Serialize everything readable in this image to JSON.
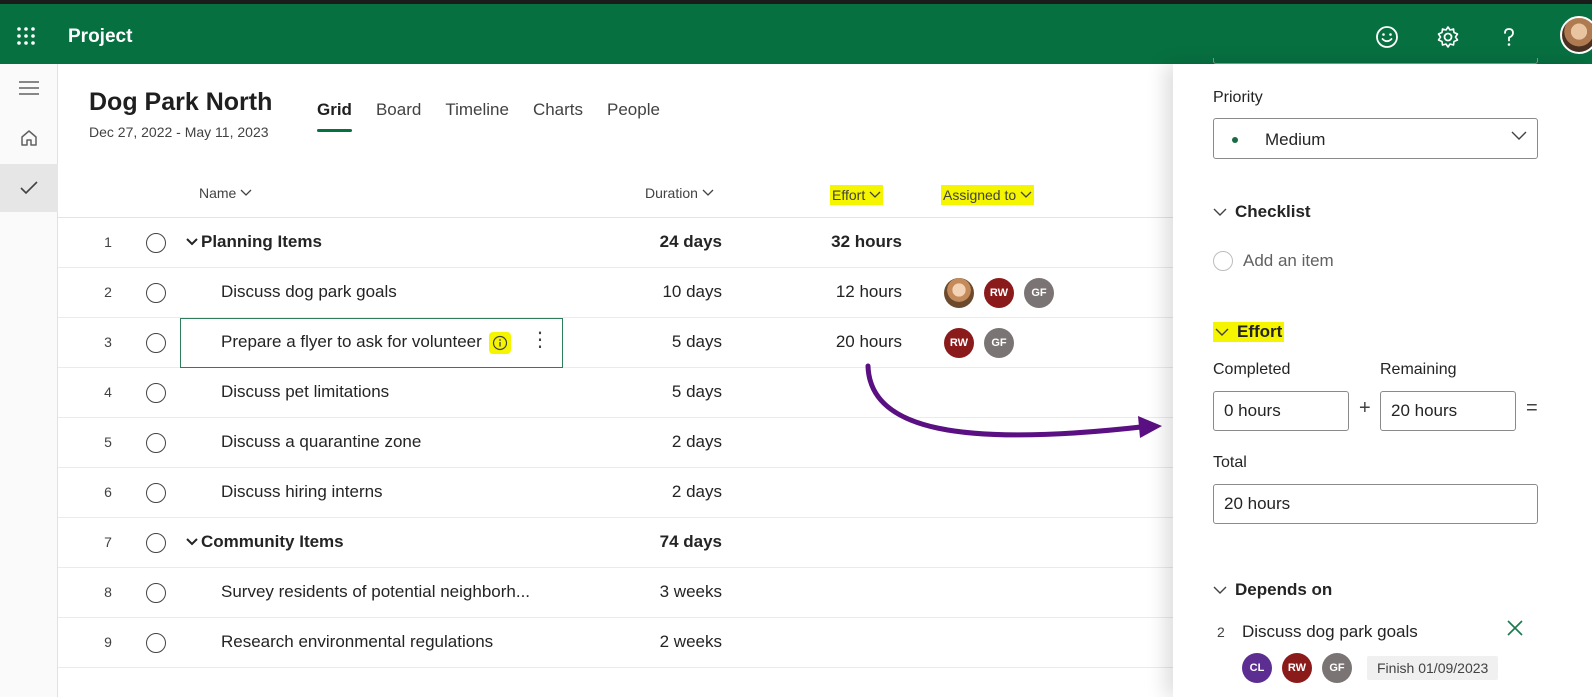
{
  "app": {
    "title": "Project"
  },
  "project": {
    "title": "Dog Park North",
    "dates": "Dec 27, 2022 - May 11, 2023",
    "tabs": [
      "Grid",
      "Board",
      "Timeline",
      "Charts",
      "People"
    ],
    "active_tab": "Grid"
  },
  "grid": {
    "headers": {
      "name": "Name",
      "duration": "Duration",
      "effort": "Effort",
      "assigned": "Assigned to"
    },
    "rows": [
      {
        "num": "1",
        "name": "Planning Items",
        "duration": "24 days",
        "effort": "32 hours",
        "group": true
      },
      {
        "num": "2",
        "name": "Discuss dog park goals",
        "duration": "10 days",
        "effort": "12 hours",
        "assigned": [
          "photo",
          "RW",
          "GF"
        ]
      },
      {
        "num": "3",
        "name": "Prepare a flyer to ask for volunteer",
        "duration": "5 days",
        "effort": "20 hours",
        "assigned": [
          "RW",
          "GF"
        ]
      },
      {
        "num": "4",
        "name": "Discuss pet limitations",
        "duration": "5 days",
        "effort": ""
      },
      {
        "num": "5",
        "name": "Discuss a quarantine zone",
        "duration": "2 days",
        "effort": ""
      },
      {
        "num": "6",
        "name": "Discuss hiring interns",
        "duration": "2 days",
        "effort": ""
      },
      {
        "num": "7",
        "name": "Community Items",
        "duration": "74 days",
        "effort": "",
        "group": true
      },
      {
        "num": "8",
        "name": "Survey residents of potential neighborh...",
        "duration": "3 weeks",
        "effort": ""
      },
      {
        "num": "9",
        "name": "Research environmental regulations",
        "duration": "2 weeks",
        "effort": ""
      }
    ],
    "avatars": {
      "rw": "RW",
      "gf": "GF",
      "cl": "CL"
    }
  },
  "panel": {
    "priority_label": "Priority",
    "priority_value": "Medium",
    "checklist_label": "Checklist",
    "add_item": "Add an item",
    "effort_label": "Effort",
    "completed_label": "Completed",
    "remaining_label": "Remaining",
    "completed_value": "0 hours",
    "remaining_value": "20 hours",
    "plus": "+",
    "equals": "=",
    "total_label": "Total",
    "total_value": "20 hours",
    "depends_label": "Depends on",
    "dep_num": "2",
    "dep_name": "Discuss dog park goals",
    "dep_finish": "Finish 01/09/2023"
  },
  "colors": {
    "brand": "#077041",
    "highlight": "#f5f500",
    "arrow": "#5a0f82"
  }
}
